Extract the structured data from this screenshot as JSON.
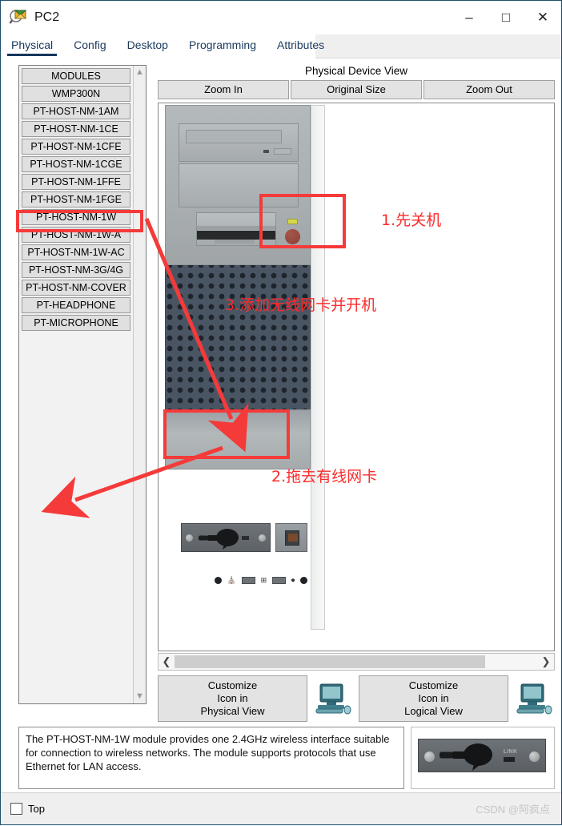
{
  "window": {
    "title": "PC2",
    "icon": "packet-tracer-inspect-icon",
    "controls": {
      "minimize": "–",
      "maximize": "□",
      "close": "✕"
    }
  },
  "tabs": [
    {
      "label": "Physical",
      "active": true
    },
    {
      "label": "Config",
      "active": false
    },
    {
      "label": "Desktop",
      "active": false
    },
    {
      "label": "Programming",
      "active": false
    },
    {
      "label": "Attributes",
      "active": false
    }
  ],
  "modules": {
    "header": "MODULES",
    "items": [
      "WMP300N",
      "PT-HOST-NM-1AM",
      "PT-HOST-NM-1CE",
      "PT-HOST-NM-1CFE",
      "PT-HOST-NM-1CGE",
      "PT-HOST-NM-1FFE",
      "PT-HOST-NM-1FGE",
      "PT-HOST-NM-1W",
      "PT-HOST-NM-1W-A",
      "PT-HOST-NM-1W-AC",
      "PT-HOST-NM-3G/4G",
      "PT-HOST-NM-COVER",
      "PT-HEADPHONE",
      "PT-MICROPHONE"
    ],
    "selected": "PT-HOST-NM-1W",
    "scroll_up_icon": "chevron-up-icon",
    "scroll_down_icon": "chevron-down-icon"
  },
  "device_view": {
    "title": "Physical Device View",
    "zoom_in": "Zoom In",
    "original_size": "Original Size",
    "zoom_out": "Zoom Out",
    "scroll_left_icon": "chevron-left-icon",
    "scroll_right_icon": "chevron-right-icon"
  },
  "customize": {
    "physical": "Customize\nIcon in\nPhysical View",
    "physical_line1": "Customize",
    "physical_line2": "Icon in",
    "physical_line3": "Physical View",
    "logical_line1": "Customize",
    "logical_line2": "Icon in",
    "logical_line3": "Logical View",
    "icon_physical": "pc-monitor-icon",
    "icon_logical": "pc-monitor-icon"
  },
  "description": "The PT-HOST-NM-1W module provides one 2.4GHz wireless interface suitable for connection to wireless networks. The module supports protocols that use Ethernet for LAN access.",
  "module_preview": {
    "link_label": "LINK"
  },
  "footer": {
    "top_checkbox_label": "Top",
    "top_checked": false,
    "watermark": "CSDN @阿疯点"
  },
  "annotations": {
    "step1": "1.先关机",
    "step2": "2.拖去有线网卡",
    "step3": "3.添加无线网卡并开机",
    "color": "#fb2b2b"
  }
}
